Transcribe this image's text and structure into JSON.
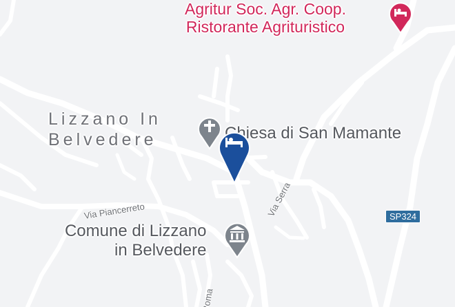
{
  "map": {
    "places": {
      "town_line1": "Lizzano In",
      "town_line2": "Belvedere",
      "agritur_line1": "Agritur Soc. Agr. Coop.",
      "agritur_line2": "Ristorante Agrituristico",
      "church": "Chiesa di San Mamante",
      "comune_line1": "Comune di Lizzano",
      "comune_line2": "in Belvedere"
    },
    "streets": {
      "via_piancerreto": "Via Piancerreto",
      "via_serra": "Via Serra",
      "via_roma": "Roma"
    },
    "road_shield": "SP324",
    "icons": {
      "hotel_marker": "hotel-bed-icon",
      "church_marker": "cross-icon",
      "comune_marker": "city-hall-icon",
      "agritur_marker": "bed-icon"
    },
    "colors": {
      "background": "#f2f3f5",
      "road": "#ffffff",
      "hotel_marker": "#1b4f9c",
      "poi_red": "#d1275a",
      "poi_grey": "#7d848c",
      "shield": "#2f6d9e"
    }
  }
}
